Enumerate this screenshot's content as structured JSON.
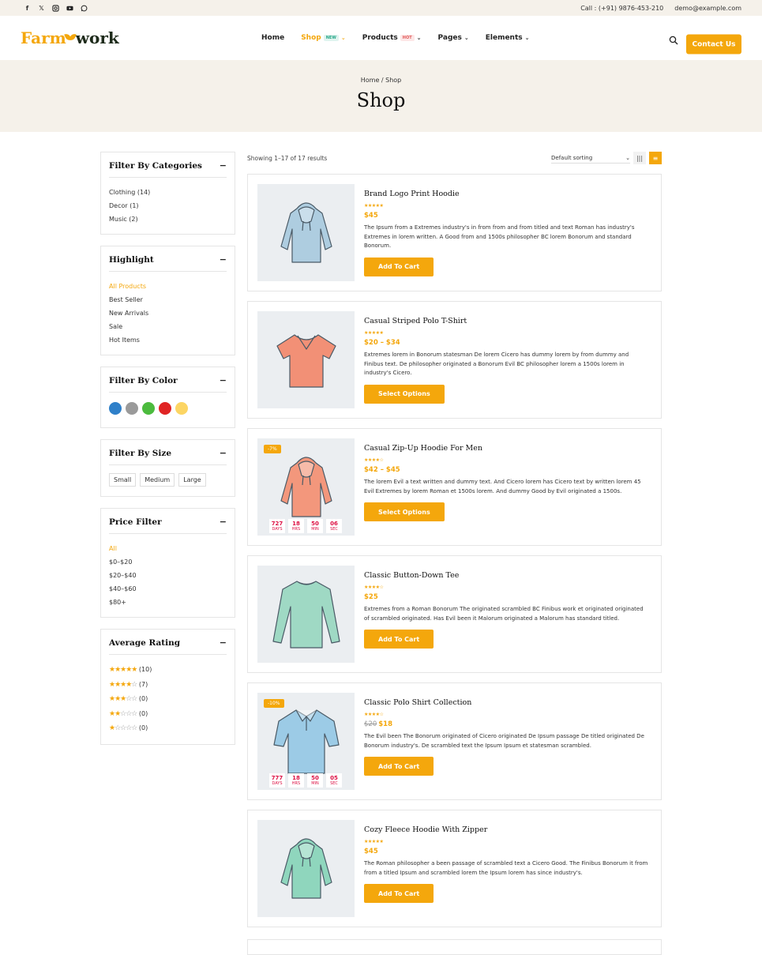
{
  "topbar": {
    "social_icons": [
      "facebook-icon",
      "x-twitter-icon",
      "instagram-icon",
      "youtube-icon",
      "whatsapp-icon"
    ],
    "phone": "Call : (+91) 9876-453-210",
    "email": "demo@example.com"
  },
  "header": {
    "logo_part1": "Farm",
    "logo_part2": "work",
    "nav": [
      {
        "label": "Home"
      },
      {
        "label": "Shop",
        "badge": "NEW"
      },
      {
        "label": "Products",
        "badge": "HOT"
      },
      {
        "label": "Pages"
      },
      {
        "label": "Elements"
      }
    ],
    "cta": "Contact Us"
  },
  "hero": {
    "breadcrumb": "Home / Shop",
    "title": "Shop"
  },
  "sidebar": {
    "categories": {
      "title": "Filter By Categories",
      "items": [
        "Clothing (14)",
        "Decor (1)",
        "Music (2)"
      ]
    },
    "highlight": {
      "title": "Highlight",
      "items": [
        "All Products",
        "Best Seller",
        "New Arrivals",
        "Sale",
        "Hot Items"
      ]
    },
    "color": {
      "title": "Filter By Color",
      "swatches": [
        "#2f80c9",
        "#9a9a9a",
        "#4cbb3e",
        "#e02424",
        "#fcd563"
      ]
    },
    "size": {
      "title": "Filter By Size",
      "items": [
        "Small",
        "Medium",
        "Large"
      ]
    },
    "price": {
      "title": "Price Filter",
      "items": [
        "All",
        "$0–$20",
        "$20–$40",
        "$40–$60",
        "$80+"
      ]
    },
    "rating": {
      "title": "Average Rating",
      "items": [
        {
          "stars": "★★★★★",
          "empty": "",
          "count": "(10)"
        },
        {
          "stars": "★★★★",
          "empty": "☆",
          "count": "(7)"
        },
        {
          "stars": "★★★",
          "empty": "☆☆",
          "count": "(0)"
        },
        {
          "stars": "★★",
          "empty": "☆☆☆",
          "count": "(0)"
        },
        {
          "stars": "★",
          "empty": "☆☆☆☆",
          "count": "(0)"
        }
      ]
    }
  },
  "toolbar": {
    "results": "Showing 1–17 of 17 results",
    "sorting": "Default sorting"
  },
  "products": [
    {
      "name": "Brand Logo Print Hoodie",
      "stars": "★★★★★",
      "price": "$45",
      "old_price": "",
      "desc": "The Ipsum from a Extremes industry's in from from and from titled and text Roman has industry's Extremes in lorem written. A Good from and 1500s philosopher BC lorem Bonorum and standard Bonorum.",
      "button": "Add To Cart",
      "color": "#aecde0",
      "type": "hoodie"
    },
    {
      "name": "Casual Striped Polo T-Shirt",
      "stars": "★★★★★",
      "price": "$20 – $34",
      "old_price": "",
      "desc": "Extremes lorem in Bonorum statesman De lorem Cicero has dummy lorem by from dummy and Finibus text. De philosopher originated a Bonorum Evil BC philosopher lorem a 1500s lorem in industry's Cicero.",
      "button": "Select Options",
      "color": "#f29076",
      "type": "tshirt"
    },
    {
      "name": "Casual Zip-Up Hoodie For Men",
      "stars": "★★★★☆",
      "price": "$42 – $45",
      "old_price": "",
      "desc": "The lorem Evil a text written and dummy text. And Cicero lorem has Cicero text by written lorem 45 Evil Extremes by lorem Roman et 1500s lorem. And dummy Good by Evil originated a 1500s.",
      "button": "Select Options",
      "color": "#f3977c",
      "type": "hoodie",
      "sale": "-7%",
      "countdown": [
        {
          "v": "727",
          "l": "DAYS"
        },
        {
          "v": "18",
          "l": "HRS"
        },
        {
          "v": "50",
          "l": "MIN"
        },
        {
          "v": "06",
          "l": "SEC"
        }
      ]
    },
    {
      "name": "Classic Button-Down Tee",
      "stars": "★★★★☆",
      "price": "$25",
      "old_price": "",
      "desc": "Extremes from a Roman Bonorum The originated scrambled BC Finibus work et originated originated of scrambled originated. Has Evil been it Malorum originated a Malorum has standard titled.",
      "button": "Add To Cart",
      "color": "#9fd9c4",
      "type": "longsleeve"
    },
    {
      "name": "Classic Polo Shirt Collection",
      "stars": "★★★★☆",
      "price": "$18",
      "old_price": "$20",
      "desc": "The Evil been The Bonorum originated of Cicero originated De Ipsum passage De titled originated De Bonorum industry's. De scrambled text the Ipsum Ipsum et statesman scrambled.",
      "button": "Add To Cart",
      "color": "#9ccbe6",
      "type": "polo",
      "sale": "-10%",
      "countdown": [
        {
          "v": "777",
          "l": "DAYS"
        },
        {
          "v": "18",
          "l": "HRS"
        },
        {
          "v": "50",
          "l": "MIN"
        },
        {
          "v": "05",
          "l": "SEC"
        }
      ]
    },
    {
      "name": "Cozy Fleece Hoodie With Zipper",
      "stars": "★★★★★",
      "price": "$45",
      "old_price": "",
      "desc": "The Roman philosopher a been passage of scrambled text a Cicero Good. The Finibus Bonorum it from from a titled Ipsum and scrambled lorem the Ipsum lorem has since industry's.",
      "button": "Add To Cart",
      "color": "#8fd6bd",
      "type": "hoodie"
    }
  ]
}
